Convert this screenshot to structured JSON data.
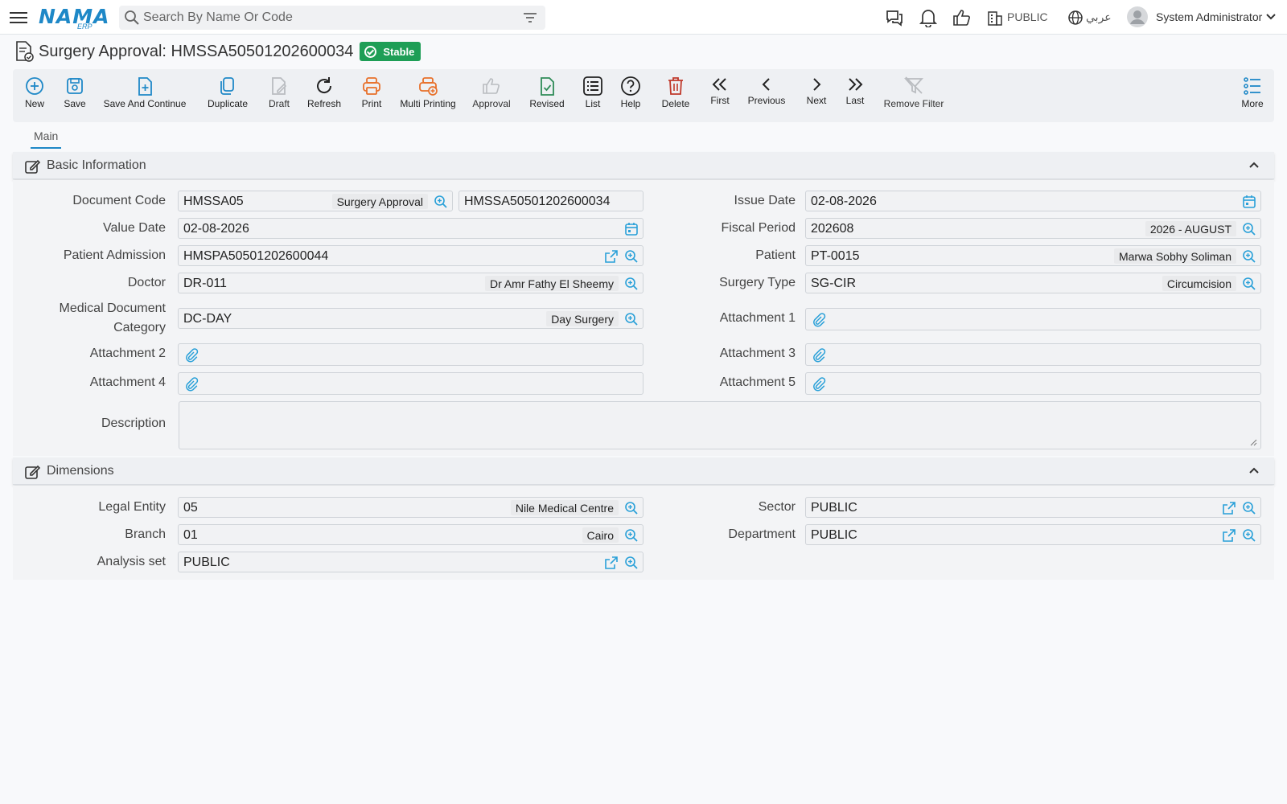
{
  "app": {
    "logo": "NAMA",
    "logo_sub": "ERP"
  },
  "search": {
    "placeholder": "Search By Name Or Code"
  },
  "topbar": {
    "sector": "PUBLIC",
    "language": "عربي",
    "user": "System Administrator"
  },
  "page": {
    "title": "Surgery Approval: HMSSA50501202600034",
    "status": "Stable"
  },
  "toolbar": {
    "new": "New",
    "save": "Save",
    "save_continue": "Save And Continue",
    "duplicate": "Duplicate",
    "draft": "Draft",
    "refresh": "Refresh",
    "print": "Print",
    "multi_printing": "Multi Printing",
    "approval": "Approval",
    "revised": "Revised",
    "list": "List",
    "help": "Help",
    "delete": "Delete",
    "first": "First",
    "previous": "Previous",
    "next": "Next",
    "last": "Last",
    "remove_filter": "Remove Filter",
    "more": "More"
  },
  "colors": {
    "accent": "#1e88c7",
    "status_green": "#1e9e56",
    "print_orange": "#e8702a",
    "delete_red": "#c0392b",
    "revised_green": "#2e8b57"
  },
  "tabs": {
    "main": "Main"
  },
  "basic": {
    "title": "Basic Information",
    "document_code": {
      "label": "Document Code",
      "value": "HMSSA05",
      "desc": "Surgery Approval",
      "code": "HMSSA50501202600034"
    },
    "issue_date": {
      "label": "Issue Date",
      "value": "02-08-2026"
    },
    "value_date": {
      "label": "Value Date",
      "value": "02-08-2026"
    },
    "fiscal_period": {
      "label": "Fiscal Period",
      "value": "202608",
      "desc": "2026 - AUGUST"
    },
    "patient_admission": {
      "label": "Patient Admission",
      "value": "HMSPA50501202600044"
    },
    "patient": {
      "label": "Patient",
      "value": "PT-0015",
      "desc": "Marwa Sobhy Soliman"
    },
    "doctor": {
      "label": "Doctor",
      "value": "DR-011",
      "desc": "Dr Amr Fathy El Sheemy"
    },
    "surgery_type": {
      "label": "Surgery Type",
      "value": "SG-CIR",
      "desc": "Circumcision"
    },
    "medical_doc_category": {
      "label_line1": "Medical Document",
      "label_line2": "Category",
      "value": "DC-DAY",
      "desc": "Day Surgery"
    },
    "attachment1": {
      "label": "Attachment 1"
    },
    "attachment2": {
      "label": "Attachment 2"
    },
    "attachment3": {
      "label": "Attachment 3"
    },
    "attachment4": {
      "label": "Attachment 4"
    },
    "attachment5": {
      "label": "Attachment 5"
    },
    "description": {
      "label": "Description",
      "value": ""
    }
  },
  "dimensions": {
    "title": "Dimensions",
    "legal_entity": {
      "label": "Legal Entity",
      "value": "05",
      "desc": "Nile Medical Centre"
    },
    "sector": {
      "label": "Sector",
      "value": "PUBLIC"
    },
    "branch": {
      "label": "Branch",
      "value": "01",
      "desc": "Cairo"
    },
    "department": {
      "label": "Department",
      "value": "PUBLIC"
    },
    "analysis_set": {
      "label": "Analysis set",
      "value": "PUBLIC"
    }
  }
}
